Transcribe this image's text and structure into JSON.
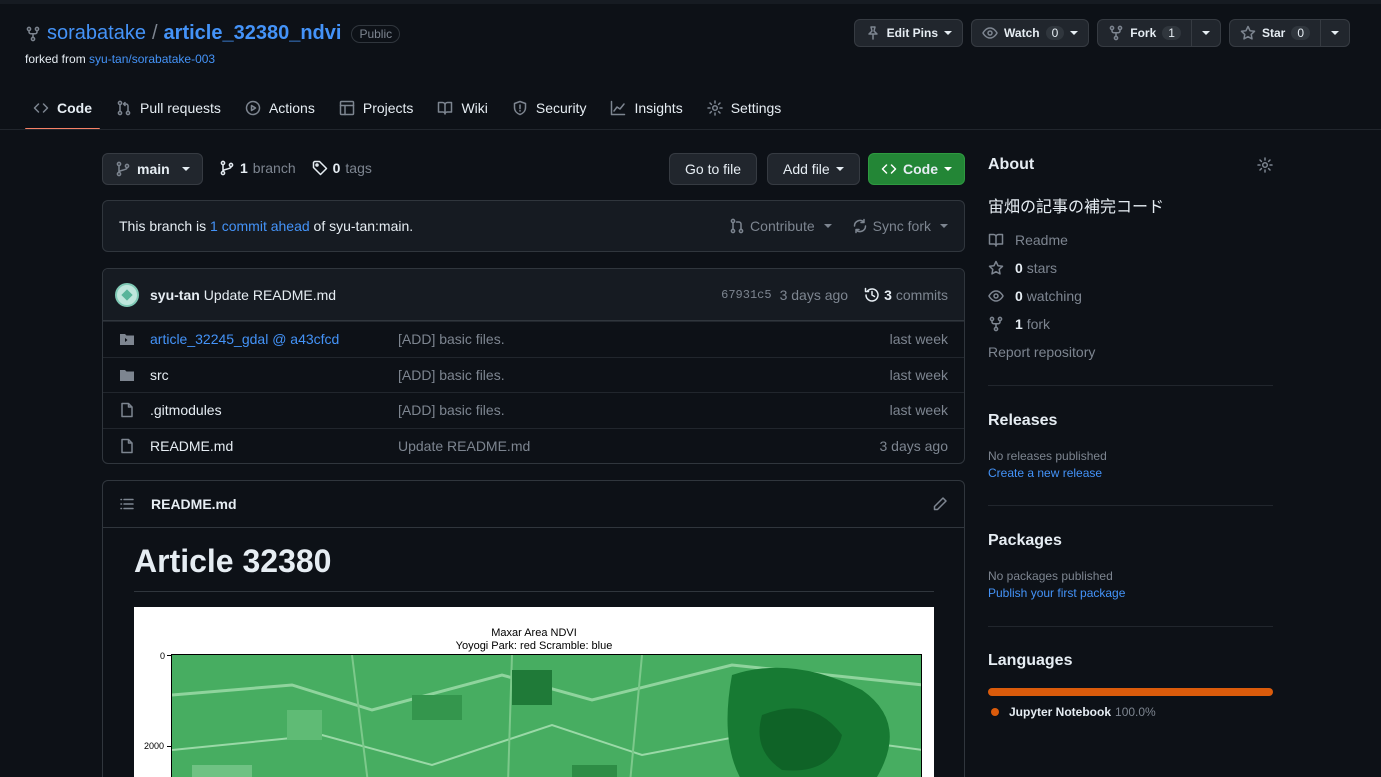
{
  "repo": {
    "owner": "sorabatake",
    "separator": "/",
    "name": "article_32380_ndvi",
    "visibility": "Public",
    "forked_prefix": "forked from",
    "forked_from": "syu-tan/sorabatake-003"
  },
  "header_actions": {
    "edit_pins": "Edit Pins",
    "watch": "Watch",
    "watch_count": "0",
    "fork": "Fork",
    "fork_count": "1",
    "star": "Star",
    "star_count": "0"
  },
  "nav": {
    "items": [
      {
        "label": "Code",
        "icon": "code-icon"
      },
      {
        "label": "Pull requests",
        "icon": "pull-request-icon"
      },
      {
        "label": "Actions",
        "icon": "play-icon"
      },
      {
        "label": "Projects",
        "icon": "table-icon"
      },
      {
        "label": "Wiki",
        "icon": "book-icon"
      },
      {
        "label": "Security",
        "icon": "shield-icon"
      },
      {
        "label": "Insights",
        "icon": "graph-icon"
      },
      {
        "label": "Settings",
        "icon": "gear-icon"
      }
    ],
    "active": "Code"
  },
  "branch": {
    "current": "main",
    "branch_count": "1",
    "branch_label": "branch",
    "tag_count": "0",
    "tag_label": "tags",
    "goto_file": "Go to file",
    "add_file": "Add file",
    "code": "Code"
  },
  "ahead": {
    "prefix": "This branch is",
    "link": "1 commit ahead",
    "suffix": "of syu-tan:main.",
    "contribute": "Contribute",
    "sync": "Sync fork"
  },
  "latest_commit": {
    "author": "syu-tan",
    "message": "Update README.md",
    "sha": "67931c5",
    "age": "3 days ago",
    "commit_count": "3",
    "commit_label": "commits"
  },
  "files": [
    {
      "name": "article_32245_gdal @ a43cfcd",
      "type": "submodule",
      "message": "[ADD] basic files.",
      "age": "last week"
    },
    {
      "name": "src",
      "type": "folder",
      "message": "[ADD] basic files.",
      "age": "last week"
    },
    {
      "name": ".gitmodules",
      "type": "file",
      "message": "[ADD] basic files.",
      "age": "last week"
    },
    {
      "name": "README.md",
      "type": "file",
      "message": "Update README.md",
      "age": "3 days ago"
    }
  ],
  "readme": {
    "filename": "README.md",
    "heading": "Article 32380",
    "figure": {
      "title_line1": "Maxar Area NDVI",
      "title_line2": "Yoyogi Park: red Scramble: blue",
      "ytick_0": "0",
      "ytick_2000": "2000"
    }
  },
  "about": {
    "title": "About",
    "description": "宙畑の記事の補完コード",
    "readme": "Readme",
    "stars_count": "0",
    "stars_label": "stars",
    "watching_count": "0",
    "watching_label": "watching",
    "fork_count": "1",
    "fork_label": "fork",
    "report": "Report repository"
  },
  "releases": {
    "title": "Releases",
    "empty": "No releases published",
    "link": "Create a new release"
  },
  "packages": {
    "title": "Packages",
    "empty": "No packages published",
    "link": "Publish your first package"
  },
  "languages": {
    "title": "Languages",
    "items": [
      {
        "name": "Jupyter Notebook",
        "percent": "100.0%",
        "color": "#da5b0b"
      }
    ]
  },
  "colors": {
    "background": "#0d1117",
    "link": "#4493f8",
    "primary_button": "#238636",
    "active_tab_underline": "#f78166"
  }
}
